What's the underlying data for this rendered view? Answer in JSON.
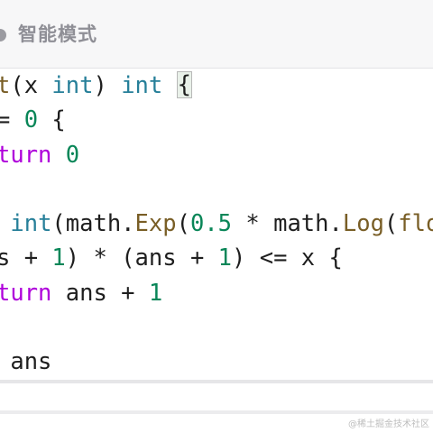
{
  "header": {
    "mode_label": "智能模式",
    "icon": "circle-dot-icon"
  },
  "code": {
    "lines": [
      [
        {
          "t": "t",
          "c": "fn"
        },
        {
          "t": "(x ",
          "c": "plain"
        },
        {
          "t": "int",
          "c": "type"
        },
        {
          "t": ") ",
          "c": "plain"
        },
        {
          "t": "int",
          "c": "type"
        },
        {
          "t": " ",
          "c": "plain"
        },
        {
          "t": "{",
          "c": "brace"
        }
      ],
      [
        {
          "t": "= ",
          "c": "plain"
        },
        {
          "t": "0",
          "c": "num"
        },
        {
          "t": " {",
          "c": "plain"
        }
      ],
      [
        {
          "t": "turn",
          "c": "kw"
        },
        {
          "t": " ",
          "c": "plain"
        },
        {
          "t": "0",
          "c": "num"
        }
      ],
      [],
      [
        {
          "t": " ",
          "c": "plain"
        },
        {
          "t": "int",
          "c": "type"
        },
        {
          "t": "(math.",
          "c": "plain"
        },
        {
          "t": "Exp",
          "c": "fn"
        },
        {
          "t": "(",
          "c": "plain"
        },
        {
          "t": "0.5",
          "c": "num"
        },
        {
          "t": " * math.",
          "c": "plain"
        },
        {
          "t": "Log",
          "c": "fn"
        },
        {
          "t": "(",
          "c": "plain"
        },
        {
          "t": "floa",
          "c": "fn"
        }
      ],
      [
        {
          "t": "s + ",
          "c": "plain"
        },
        {
          "t": "1",
          "c": "num"
        },
        {
          "t": ") * (ans + ",
          "c": "plain"
        },
        {
          "t": "1",
          "c": "num"
        },
        {
          "t": ") <= x {",
          "c": "plain"
        }
      ],
      [
        {
          "t": "turn",
          "c": "kw"
        },
        {
          "t": " ans + ",
          "c": "plain"
        },
        {
          "t": "1",
          "c": "num"
        }
      ],
      [],
      [
        {
          "t": " ans",
          "c": "plain"
        }
      ]
    ]
  },
  "watermark": "@稀土掘金技术社区",
  "colors": {
    "keyword": "#af00db",
    "type": "#267f99",
    "number": "#098658",
    "function": "#795e26",
    "text": "#1e1e1e"
  }
}
